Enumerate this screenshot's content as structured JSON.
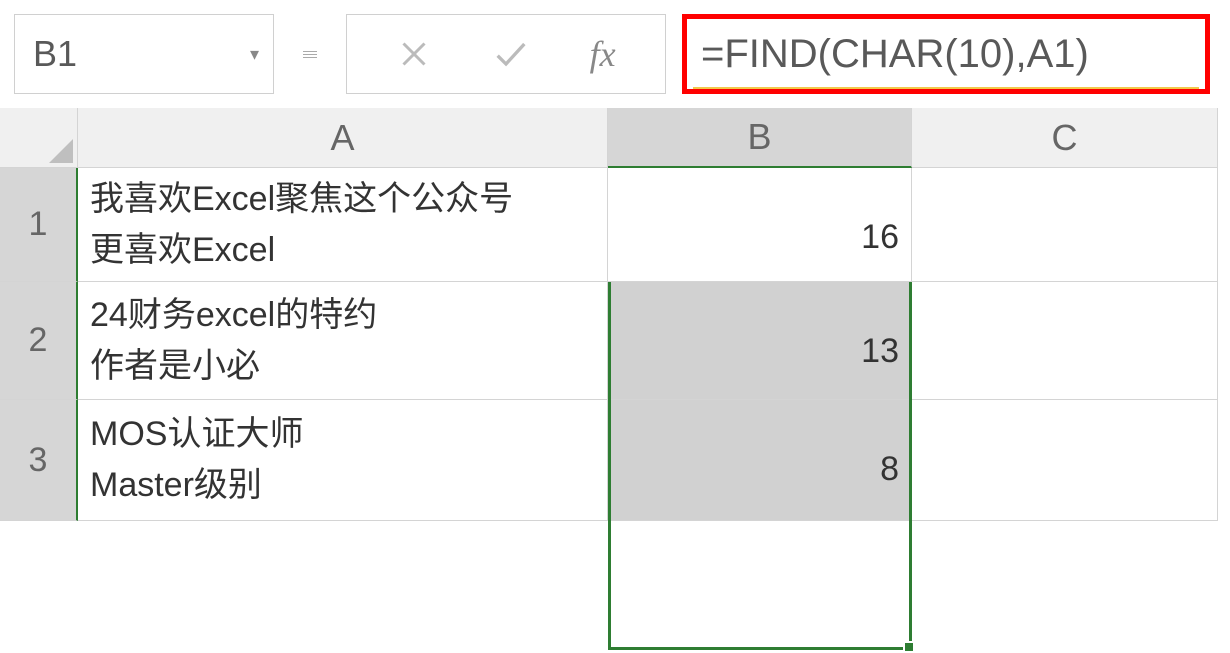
{
  "nameBox": "B1",
  "formula": "=FIND(CHAR(10),A1)",
  "columns": [
    "A",
    "B",
    "C"
  ],
  "rowNumbers": [
    "1",
    "2",
    "3"
  ],
  "cells": {
    "A1": "我喜欢Excel聚焦这个公众号\n更喜欢Excel",
    "A2": "24财务excel的特约\n作者是小必",
    "A3": "MOS认证大师\nMaster级别",
    "B1": "16",
    "B2": "13",
    "B3": "8"
  },
  "icons": {
    "cancel": "✕",
    "confirm": "✓",
    "fx": "fx",
    "dropdown": "▾"
  }
}
